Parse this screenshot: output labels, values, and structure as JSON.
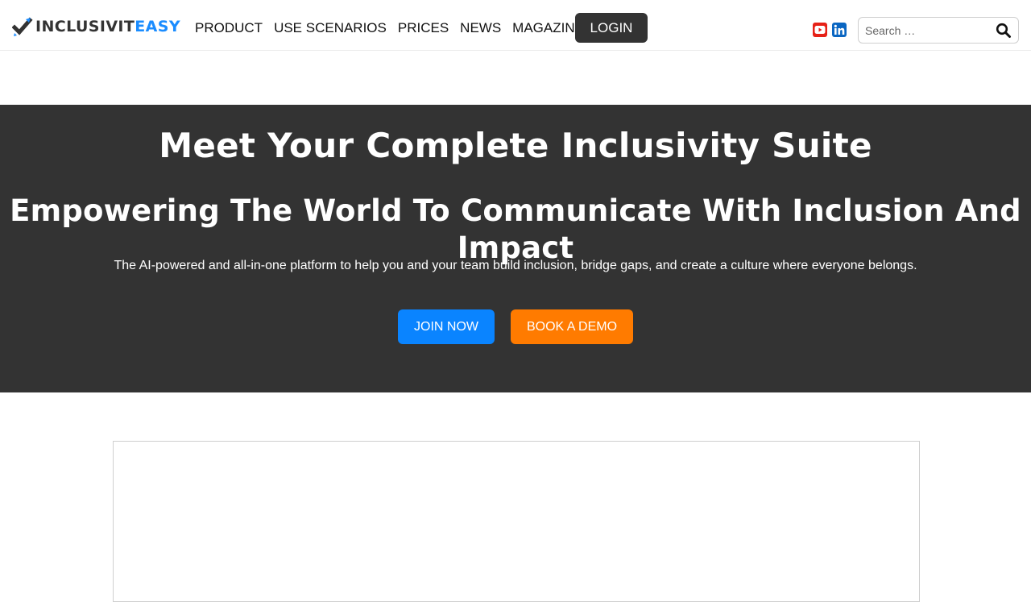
{
  "header": {
    "logo": {
      "text_main": "INCLUSIVIT",
      "text_accent": "EASY",
      "icon": "check-pen-logo-icon"
    },
    "nav": [
      "PRODUCT",
      "USE SCENARIOS",
      "PRICES",
      "NEWS",
      "MAGAZINE"
    ],
    "login_label": "LOGIN",
    "social": [
      {
        "icon": "youtube-icon",
        "color": "#e62117"
      },
      {
        "icon": "linkedin-icon",
        "color": "#0a66c2"
      }
    ],
    "search": {
      "placeholder": "Search …",
      "icon": "search-icon"
    }
  },
  "hero": {
    "title": "Meet Your Complete Inclusivity Suite",
    "subtitle": "Empowering The World To Communicate With Inclusion And Impact",
    "description": "The AI-powered and all-in-one platform to help you and your team build inclusion, bridge gaps, and create a culture where everyone belongs.",
    "join_label": "JOIN NOW",
    "demo_label": "BOOK A DEMO"
  },
  "colors": {
    "hero_bg": "#333333",
    "accent_blue": "#0a84ff",
    "accent_orange": "#ff7b00",
    "logo_accent": "#1a8cff"
  }
}
